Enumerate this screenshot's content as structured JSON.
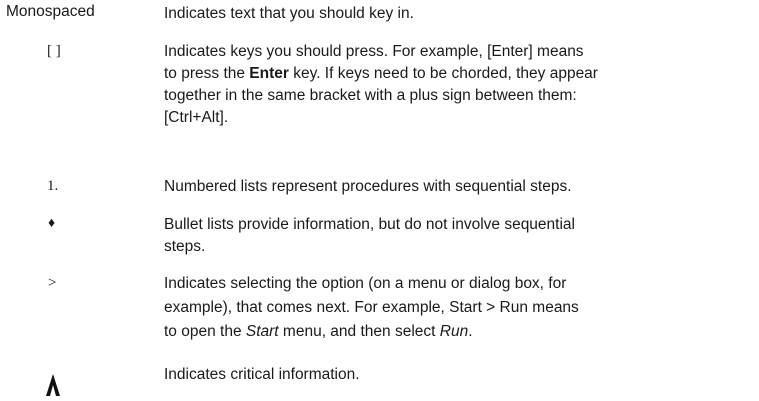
{
  "conventions": [
    {
      "symbol": "Monospaced",
      "lines": [
        "Indicates text that you should key in."
      ]
    },
    {
      "symbol": "[ ]",
      "text_1": "Indicates keys you should press. For example, [Enter] means",
      "text_2a": "to press the ",
      "text_2b": "Enter",
      "text_2c": " key. If keys need to be chorded, they appear",
      "text_3": "together in the same bracket with a plus sign between them:",
      "text_4": "[Ctrl+Alt]."
    },
    {
      "symbol": "1.",
      "lines": [
        "Numbered lists represent procedures with sequential steps."
      ]
    },
    {
      "symbol": "♦",
      "lines": [
        "Bullet lists provide information, but do not involve sequential",
        "steps."
      ]
    },
    {
      "symbol": ">",
      "text_1": "Indicates selecting the option (on a menu or dialog box, for",
      "text_2": "example), that comes next. For example, Start > Run means",
      "text_3a": "to open the ",
      "text_3b": "Start",
      "text_3c": " menu, and then select ",
      "text_3d": "Run",
      "text_3e": "."
    },
    {
      "symbol": "caution-icon",
      "lines": [
        "Indicates critical information."
      ]
    }
  ]
}
